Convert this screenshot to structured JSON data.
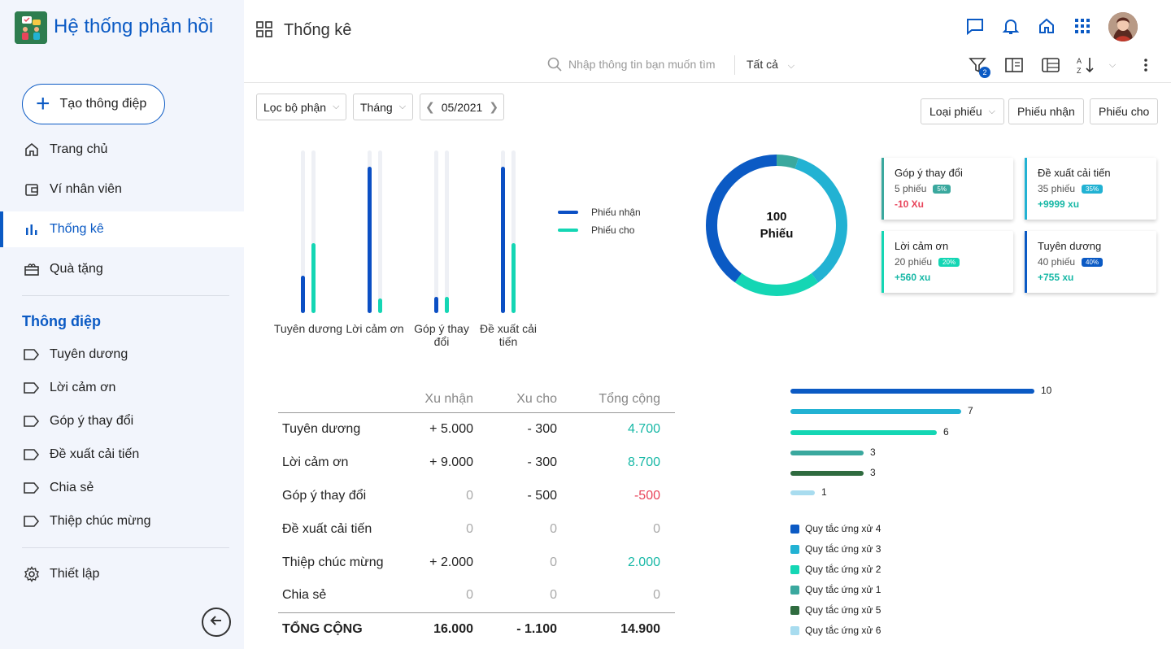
{
  "app": {
    "title": "Hệ thống phản hồi"
  },
  "header": {
    "page_title": "Thống kê"
  },
  "sidebar": {
    "create_label": "Tạo thông điệp",
    "nav": [
      {
        "label": "Trang chủ",
        "icon": "home-icon"
      },
      {
        "label": "Ví nhân viên",
        "icon": "wallet-icon"
      },
      {
        "label": "Thống kê",
        "icon": "bar-chart-icon",
        "active": true
      },
      {
        "label": "Quà tặng",
        "icon": "gift-icon"
      }
    ],
    "section_title": "Thông điệp",
    "tags": [
      "Tuyên dương",
      "Lời cảm ơn",
      "Góp ý thay đổi",
      "Đề xuất cải tiến",
      "Chia sẻ",
      "Thiệp chúc mừng"
    ],
    "settings_label": "Thiết lập"
  },
  "search": {
    "placeholder": "Nhập thông tin bạn muốn tìm",
    "scope": "Tất cả"
  },
  "toolbar": {
    "filter_badge": "2"
  },
  "filters": {
    "department": "Lọc bộ phận",
    "period": "Tháng",
    "date": "05/2021",
    "type": "Loại phiếu",
    "received": "Phiếu nhận",
    "given": "Phiếu cho"
  },
  "chart_data": [
    {
      "type": "bar",
      "categories": [
        "Tuyên dương",
        "Lời cảm ơn",
        "Góp ý thay đổi",
        "Đề xuất cải tiến"
      ],
      "series": [
        {
          "name": "Phiếu nhận",
          "values": [
            23,
            90,
            10,
            90
          ],
          "color": "#0b4fc4"
        },
        {
          "name": "Phiếu cho",
          "values": [
            43,
            9,
            10,
            43
          ],
          "color": "#14d6b4"
        }
      ],
      "ylim": [
        0,
        100
      ]
    },
    {
      "type": "pie",
      "center_value": "100",
      "center_label": "Phiếu",
      "slices": [
        {
          "label": "Góp ý thay đổi",
          "value": 5,
          "color": "#3aa89e"
        },
        {
          "label": "Đề xuất cải tiến",
          "value": 35,
          "color": "#22b2d3"
        },
        {
          "label": "Lời cảm ơn",
          "value": 20,
          "color": "#14d6b4"
        },
        {
          "label": "Tuyên dương",
          "value": 40,
          "color": "#0b5ac4"
        }
      ]
    },
    {
      "type": "bar",
      "orientation": "horizontal",
      "categories": [
        "Quy tắc ứng xử 4",
        "Quy tắc ứng xử 3",
        "Quy tắc ứng xử 2",
        "Quy tắc ứng xử 1",
        "Quy tắc ứng xử 5",
        "Quy tắc ứng xử 6"
      ],
      "values": [
        10,
        7,
        6,
        3,
        3,
        1
      ],
      "colors": [
        "#0b5ac4",
        "#22b2d3",
        "#14d6b4",
        "#3aa89e",
        "#2f6b3f",
        "#a8dcef"
      ],
      "xlim": [
        0,
        10
      ]
    }
  ],
  "cards": [
    {
      "title": "Góp ý thay đổi",
      "count": "5 phiếu",
      "pct": "5%",
      "value": "-10 Xu",
      "color": "#3aa89e",
      "value_color": "#e8455b"
    },
    {
      "title": "Đề xuất cải tiến",
      "count": "35 phiếu",
      "pct": "35%",
      "value": "+9999 xu",
      "color": "#22b2d3",
      "value_color": "#17b8a6"
    },
    {
      "title": "Lời cảm ơn",
      "count": "20 phiếu",
      "pct": "20%",
      "value": "+560 xu",
      "color": "#14d6b4",
      "value_color": "#17b8a6"
    },
    {
      "title": "Tuyên dương",
      "count": "40 phiếu",
      "pct": "40%",
      "value": "+755 xu",
      "color": "#0b5ac4",
      "value_color": "#17b8a6"
    }
  ],
  "table": {
    "headers": [
      "",
      "Xu nhận",
      "Xu cho",
      "Tổng cộng"
    ],
    "rows": [
      [
        "Tuyên dương",
        "+ 5.000",
        "- 300",
        "4.700"
      ],
      [
        "Lời cảm ơn",
        "+ 9.000",
        "- 300",
        "8.700"
      ],
      [
        "Góp ý thay đổi",
        "0",
        "- 500",
        "-500"
      ],
      [
        "Đề xuất cải tiến",
        "0",
        "0",
        "0"
      ],
      [
        "Thiệp chúc mừng",
        "+ 2.000",
        "0",
        "2.000"
      ],
      [
        "Chia sẻ",
        "0",
        "0",
        "0"
      ]
    ],
    "total": [
      "TỔNG CỘNG",
      "16.000",
      "- 1.100",
      "14.900"
    ]
  }
}
